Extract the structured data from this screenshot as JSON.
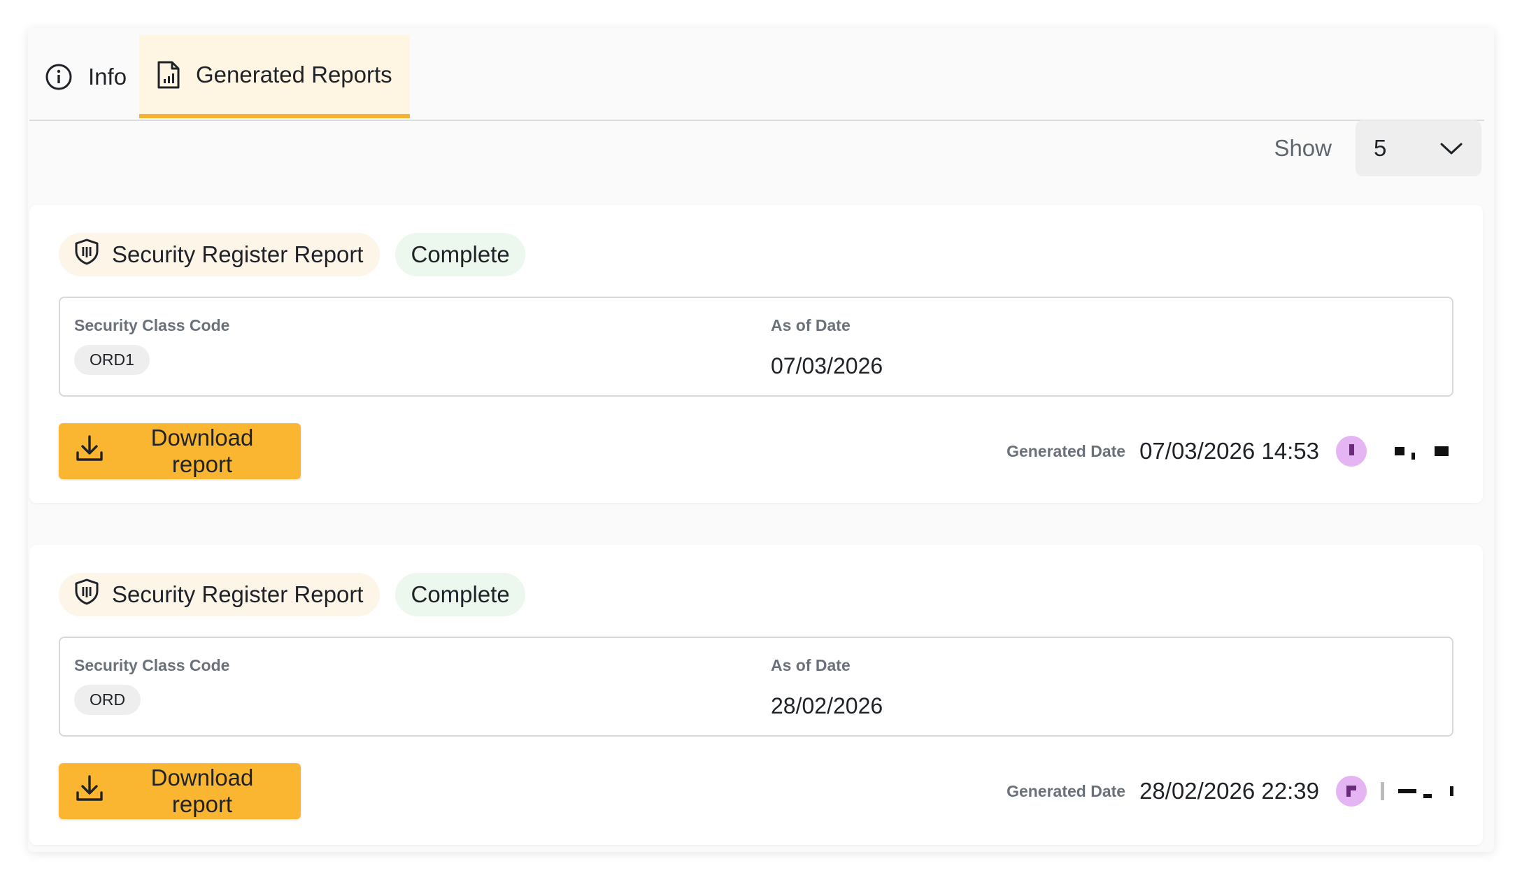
{
  "tabs": [
    {
      "label": "Info",
      "icon": "info-icon",
      "active": false
    },
    {
      "label": "Generated Reports",
      "icon": "report-icon",
      "active": true
    }
  ],
  "toolbar": {
    "show_label": "Show",
    "page_size": "5"
  },
  "reports": [
    {
      "type": "Security Register Report",
      "status": "Complete",
      "security_class_code_label": "Security Class Code",
      "security_class_code": "ORD1",
      "as_of_date_label": "As of Date",
      "as_of_date": "07/03/2026",
      "download_label": "Download report",
      "generated_date_label": "Generated Date",
      "generated_date": "07/03/2026 14:53"
    },
    {
      "type": "Security Register Report",
      "status": "Complete",
      "security_class_code_label": "Security Class Code",
      "security_class_code": "ORD",
      "as_of_date_label": "As of Date",
      "as_of_date": "28/02/2026",
      "download_label": "Download report",
      "generated_date_label": "Generated Date",
      "generated_date": "28/02/2026 22:39"
    }
  ],
  "colors": {
    "accent": "#fbb631",
    "tab_active_bg": "#fef5e3",
    "status_bg": "#ecf8ee",
    "type_chip_bg": "#fef5e9",
    "avatar": "#e4b5f2"
  }
}
